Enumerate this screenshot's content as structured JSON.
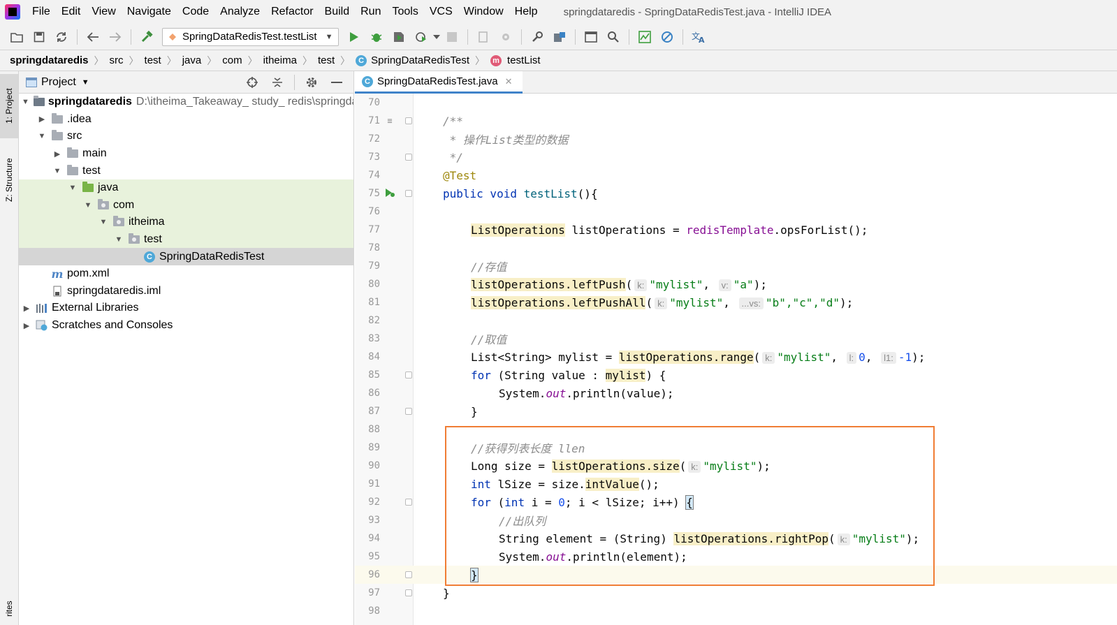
{
  "menubar": {
    "items": [
      "File",
      "Edit",
      "View",
      "Navigate",
      "Code",
      "Analyze",
      "Refactor",
      "Build",
      "Run",
      "Tools",
      "VCS",
      "Window",
      "Help"
    ],
    "window_title": "springdataredis - SpringDataRedisTest.java - IntelliJ IDEA"
  },
  "toolbar": {
    "run_config": "SpringDataRedisTest.testList"
  },
  "breadcrumb": [
    "springdataredis",
    "src",
    "test",
    "java",
    "com",
    "itheima",
    "test",
    "SpringDataRedisTest",
    "testList"
  ],
  "left_stripe": {
    "project_tab": "1: Project",
    "structure_tab": "Z: Structure",
    "favorites_tab": "rites"
  },
  "project_panel": {
    "title": "Project",
    "tree": [
      {
        "label": "springdataredis",
        "path": "D:\\itheima_Takeaway_ study_ redis\\springdataredis",
        "expanded": true,
        "icon": "module-folder-icon"
      },
      {
        "label": ".idea",
        "expanded": false,
        "icon": "folder-icon"
      },
      {
        "label": "src",
        "expanded": true,
        "icon": "folder-icon"
      },
      {
        "label": "main",
        "expanded": false,
        "icon": "folder-icon"
      },
      {
        "label": "test",
        "expanded": true,
        "icon": "folder-icon"
      },
      {
        "label": "java",
        "expanded": true,
        "icon": "test-source-folder-icon"
      },
      {
        "label": "com",
        "expanded": true,
        "icon": "package-icon"
      },
      {
        "label": "itheima",
        "expanded": true,
        "icon": "package-icon"
      },
      {
        "label": "test",
        "expanded": true,
        "icon": "package-icon"
      },
      {
        "label": "SpringDataRedisTest",
        "icon": "class-icon"
      },
      {
        "label": "pom.xml",
        "icon": "maven-icon"
      },
      {
        "label": "springdataredis.iml",
        "icon": "iml-file-icon"
      },
      {
        "label": "External Libraries",
        "expanded": false,
        "icon": "libraries-icon"
      },
      {
        "label": "Scratches and Consoles",
        "expanded": false,
        "icon": "scratches-icon"
      }
    ]
  },
  "editor": {
    "tab_label": "SpringDataRedisTest.java",
    "line_numbers": [
      "70",
      "71",
      "72",
      "73",
      "74",
      "75",
      "76",
      "77",
      "78",
      "79",
      "80",
      "81",
      "82",
      "83",
      "84",
      "85",
      "86",
      "87",
      "88",
      "89",
      "90",
      "91",
      "92",
      "93",
      "94",
      "95",
      "96",
      "97",
      "98"
    ],
    "code": {
      "l71": "/**",
      "l72": " * 操作List类型的数据",
      "l73": " */",
      "l74": "@Test",
      "l75_kw": "public void",
      "l75_fn": "testList",
      "l75_rest": "(){",
      "l77_type": "ListOperations",
      "l77_rest": " listOperations = ",
      "l77_field": "redisTemplate",
      "l77_end": ".opsForList();",
      "l79": "//存值",
      "l80_call": "listOperations.leftPush",
      "l80_hint_k": "k:",
      "l80_str1": "\"mylist\"",
      "l80_hint_v": "v:",
      "l80_str2": "\"a\"",
      "l81_call": "listOperations.leftPushAll",
      "l81_hint_k": "k:",
      "l81_str1": "\"mylist\"",
      "l81_hint_vs": "...vs:",
      "l81_strs": "\"b\",\"c\",\"d\"",
      "l83": "//取值",
      "l84_pre": "List<String> mylist = ",
      "l84_call": "listOperations.range",
      "l84_hint_k": "k:",
      "l84_str": "\"mylist\"",
      "l84_hint_l": "l:",
      "l84_n1": "0",
      "l84_hint_l1": "l1:",
      "l84_n2": "-1",
      "l85_kw": "for",
      "l85_rest": " (String value : ",
      "l85_var": "mylist",
      "l85_end": ") {",
      "l86_pre": "System.",
      "l86_out": "out",
      "l86_end": ".println(value);",
      "l87": "}",
      "l89": "//获得列表长度 llen",
      "l90_pre": "Long size = ",
      "l90_call": "listOperations.size",
      "l90_hint_k": "k:",
      "l90_str": "\"mylist\"",
      "l91_kw": "int",
      "l91_pre": " lSize = size.",
      "l91_call": "intValue",
      "l91_end": "();",
      "l92_kw1": "for",
      "l92_kw2": "int",
      "l92_pre": " i = ",
      "l92_num": "0",
      "l92_end": "; i < lSize; i++) ",
      "l93": "//出队列",
      "l94_pre": "String element = (String) ",
      "l94_call": "listOperations.rightPop",
      "l94_hint_k": "k:",
      "l94_str": "\"mylist\"",
      "l95_pre": "System.",
      "l95_out": "out",
      "l95_end": ".println(element);",
      "l96": "}",
      "l97": "}"
    }
  },
  "colors": {
    "highlight_box": "#f07d34",
    "keyword": "#0033b3",
    "string": "#067d17",
    "comment": "#8c8c8c",
    "annotation": "#9e880d"
  }
}
